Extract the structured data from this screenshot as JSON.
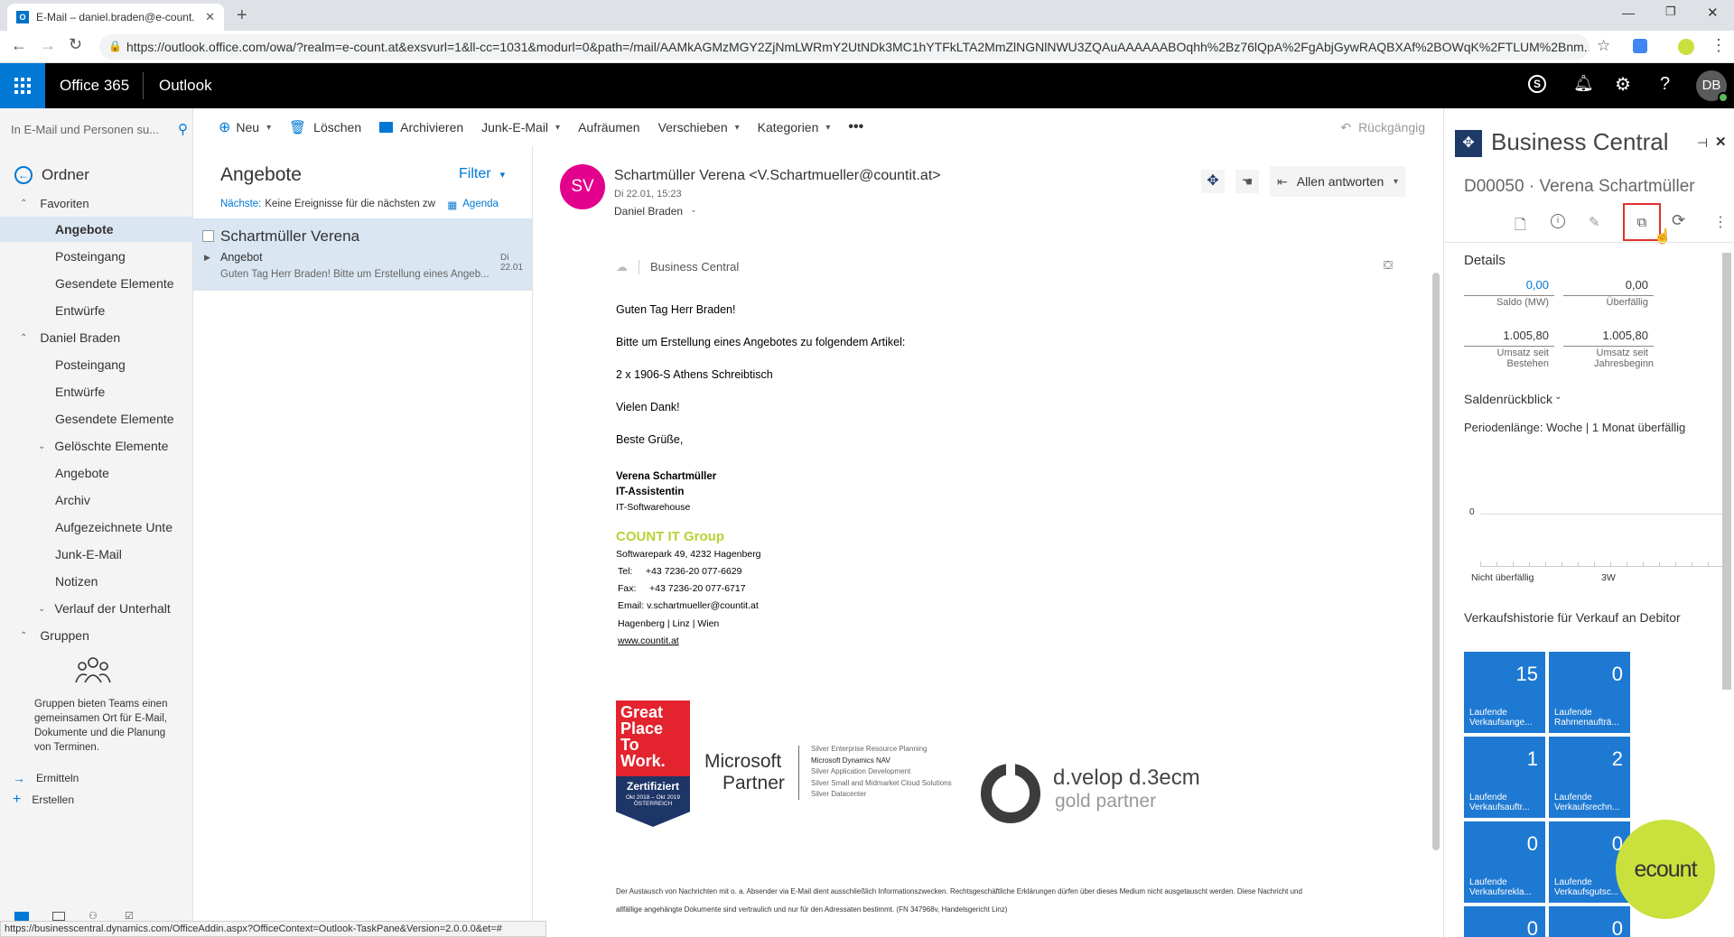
{
  "browser": {
    "tab_title": "E-Mail – daniel.braden@e-count.",
    "url": "https://outlook.office.com/owa/?realm=e-count.at&exsvurl=1&ll-cc=1031&modurl=0&path=/mail/AAMkAGMzMGY2ZjNmLWRmY2UtNDk3MC1hYTFkLTA2MmZlNGNlNWU3ZQAuAAAAAABOqhh%2Bz76lQpA%2FgAbjGywRAQBXAf%2BOWqK%2FTLUM%2Bnm...",
    "status_url": "https://businesscentral.dynamics.com/OfficeAddin.aspx?OfficeContext=Outlook-TaskPane&Version=2.0.0.0&et=#"
  },
  "suite": {
    "brand": "Office 365",
    "app": "Outlook",
    "avatar": "DB"
  },
  "search": {
    "placeholder": "In E-Mail und Personen su..."
  },
  "toolbar": {
    "new": "Neu",
    "delete": "Löschen",
    "archive": "Archivieren",
    "junk": "Junk-E-Mail",
    "sweep": "Aufräumen",
    "move": "Verschieben",
    "categories": "Kategorien",
    "undo": "Rückgängig"
  },
  "nav": {
    "folders_title": "Ordner",
    "favorites": "Favoriten",
    "fav_items": [
      "Angebote",
      "Posteingang",
      "Gesendete Elemente",
      "Entwürfe"
    ],
    "account": "Daniel Braden",
    "acc_items": [
      "Posteingang",
      "Entwürfe",
      "Gesendete Elemente"
    ],
    "deleted": "Gelöschte Elemente",
    "deleted_items": [
      "Angebote",
      "Archiv",
      "Aufgezeichnete Unte",
      "Junk-E-Mail",
      "Notizen"
    ],
    "history": "Verlauf der Unterhalt",
    "groups": "Gruppen",
    "groups_desc": "Gruppen bieten Teams einen gemeinsamen Ort für E-Mail, Dokumente und die Planung von Terminen.",
    "discover": "Ermitteln",
    "create": "Erstellen"
  },
  "list": {
    "folder_title": "Angebote",
    "filter": "Filter",
    "next_label": "Nächste:",
    "next_text": "Keine Ereignisse für die nächsten zw",
    "agenda": "Agenda",
    "message": {
      "sender": "Schartmüller Verena",
      "subject": "Angebot",
      "date": "Di 22.01",
      "preview": "Guten Tag Herr Braden!  Bitte um Erstellung eines Angeb..."
    }
  },
  "email": {
    "initials": "SV",
    "from": "Schartmüller Verena <V.Schartmueller@countit.at>",
    "date": "Di 22.01, 15:23",
    "to": "Daniel Braden",
    "reply_all": "Allen antworten",
    "addin": "Business Central",
    "body": [
      "Guten Tag Herr Braden!",
      "Bitte um Erstellung eines Angebotes zu folgendem Artikel:",
      "2 x 1906-S Athens Schreibtisch",
      "Vielen Dank!",
      "Beste Grüße,"
    ],
    "sig_name": "Verena Schartmüller",
    "sig_role": "IT-Assistentin",
    "sig_dept": "IT-Softwarehouse",
    "company": "COUNT IT Group",
    "address": "Softwarepark 49, 4232 Hagenberg",
    "tel": "Tel:     +43 7236-20 077-6629",
    "fax": "Fax:     +43 7236-20 077-6717",
    "mail": "Email: v.schartmueller@countit.at",
    "cities": "Hagenberg | Linz | Wien",
    "web": "www.countit.at",
    "gptw": [
      "Great",
      "Place",
      "To",
      "Work."
    ],
    "gptw_cert": "Zertifiziert",
    "gptw_sub": "Okt 2018 – Okt 2019",
    "gptw_country": "ÖSTERREICH",
    "ms_partner": [
      "Microsoft",
      "Partner"
    ],
    "ms_lines": [
      "Silver Enterprise Resource Planning",
      "Microsoft Dynamics NAV",
      "Silver Application Development",
      "Silver Small and Midmarket Cloud Solutions",
      "Silver Datacenter"
    ],
    "dvelop": "d.velop d.3ecm",
    "dvelop_sub": "gold partner",
    "disclaimer1": "Der Austausch von Nachrichten mit o. a. Absender via E-Mail dient ausschließlich Informationszwecken. Rechtsgeschäftliche Erklärungen dürfen über dieses Medium nicht ausgetauscht werden. Diese Nachricht und",
    "disclaimer2": "allfällige angehängte Dokumente sind vertraulich und nur für den Adressaten bestimmt. (FN 347968v, Handelsgericht Linz)"
  },
  "bc": {
    "title": "Business Central",
    "customer": "D00050 · Verena Schartmüller",
    "details": "Details",
    "stats": [
      {
        "value": "0,00",
        "label": "Saldo (MW)",
        "link": true
      },
      {
        "value": "0,00",
        "label": "Überfällig",
        "link": false
      },
      {
        "value": "1.005,80",
        "label": "Umsatz seit Bestehen",
        "link": false
      },
      {
        "value": "1.005,80",
        "label": "Umsatz seit Jahresbeginn",
        "link": false
      }
    ],
    "aging_title": "Saldenrückblick",
    "aging_period": "Periodenlänge: Woche | 1 Monat überfällig",
    "chart_zero": "0",
    "chart_x": [
      "Nicht überfällig",
      "3W"
    ],
    "history_title": "Verkaufshistorie für Verkauf an Debitor",
    "tiles": [
      {
        "value": "15",
        "label": "Laufende Verkaufsange..."
      },
      {
        "value": "0",
        "label": "Laufende Rahmenaufträ..."
      },
      {
        "value": "1",
        "label": "Laufende Verkaufsauftr..."
      },
      {
        "value": "2",
        "label": "Laufende Verkaufsrechn..."
      },
      {
        "value": "0",
        "label": "Laufende Verkaufsrekla..."
      },
      {
        "value": "0",
        "label": "Laufende Verkaufsgutsc..."
      },
      {
        "value": "0",
        "label": ""
      },
      {
        "value": "0",
        "label": ""
      }
    ],
    "brand_logo": "ecount"
  },
  "colors": {
    "accent": "#0078d4",
    "tile": "#1e79d2",
    "avatar": "#e3008c",
    "company": "#b6d334",
    "logo_circle": "#c9e03d"
  }
}
